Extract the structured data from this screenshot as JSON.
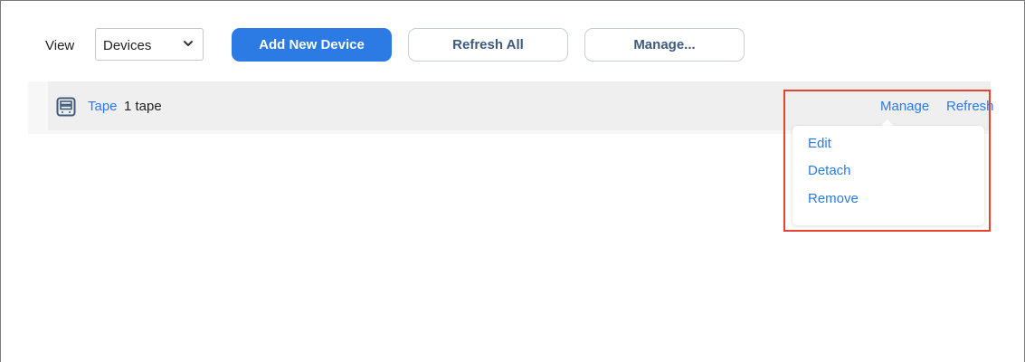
{
  "toolbar": {
    "view_label": "View",
    "view_select_value": "Devices",
    "add_button_label": "Add New Device",
    "refresh_all_label": "Refresh All",
    "manage_label": "Manage..."
  },
  "device_row": {
    "name": "Tape",
    "count_text": "1 tape",
    "manage_link": "Manage",
    "refresh_link": "Refresh",
    "icon": "tape-device-icon"
  },
  "dropdown": {
    "items": [
      {
        "label": "Edit"
      },
      {
        "label": "Detach"
      },
      {
        "label": "Remove"
      }
    ]
  },
  "colors": {
    "accent": "#2c7be5",
    "highlight": "#e8432f",
    "row_bg": "#efefef"
  }
}
